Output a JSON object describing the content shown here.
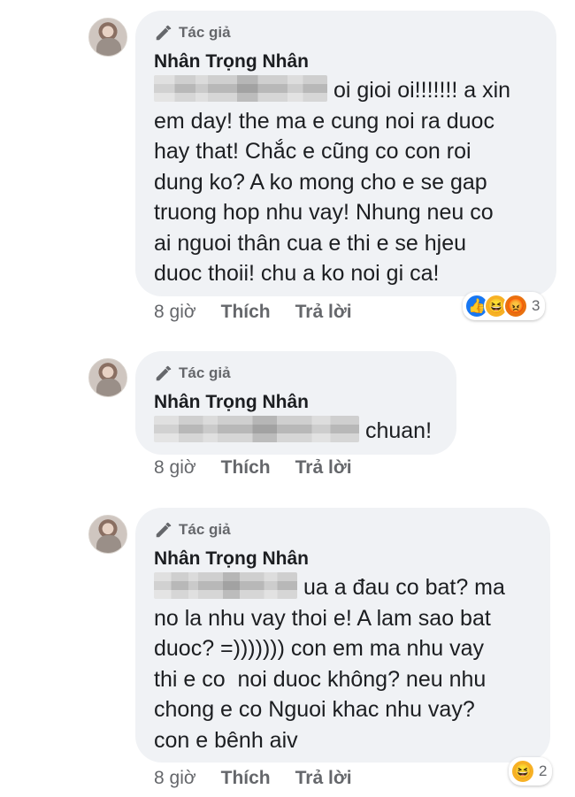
{
  "comments": [
    {
      "badge": "Tác giả",
      "author": "Nhân Trọng Nhân",
      "text_after_redaction": "oi gioi oi!!!!!!! a xin",
      "lines": [
        "em day! the ma e cung noi ra duoc",
        "hay that! Chắc e cũng co con roi",
        "dung ko? A ko mong cho e se gap",
        "truong hop nhu vay! Nhung neu co",
        "ai nguoi thân cua e thi e se hjeu",
        "duoc thoii! chu a ko noi gi ca!"
      ],
      "time": "8 giờ",
      "like": "Thích",
      "reply": "Trả lời",
      "reactions": {
        "icons": [
          "like-icon",
          "haha-icon",
          "angry-icon"
        ],
        "count": "3"
      }
    },
    {
      "badge": "Tác giả",
      "author": "Nhân Trọng Nhân",
      "text_after_redaction": "chuan!",
      "time": "8 giờ",
      "like": "Thích",
      "reply": "Trả lời"
    },
    {
      "badge": "Tác giả",
      "author": "Nhân Trọng Nhân",
      "text_after_redaction": "ua a đau co bat? ma",
      "lines": [
        "no la nhu vay thoi e! A lam sao bat",
        "duoc? =))))))) con em ma nhu vay",
        "thi e co  noi duoc không? neu nhu",
        "chong e co Nguoi khac nhu vay?",
        "con e bênh aiv"
      ],
      "time": "8 giờ",
      "like": "Thích",
      "reply": "Trả lời",
      "reactions": {
        "icons": [
          "haha-icon"
        ],
        "count": "2"
      }
    }
  ],
  "colors": {
    "bubble": "#f0f2f5",
    "meta_text": "#65676b",
    "like_blue": "#1877f2",
    "haha_yellow": "#f7b125",
    "angry_orange": "#e9710f"
  }
}
